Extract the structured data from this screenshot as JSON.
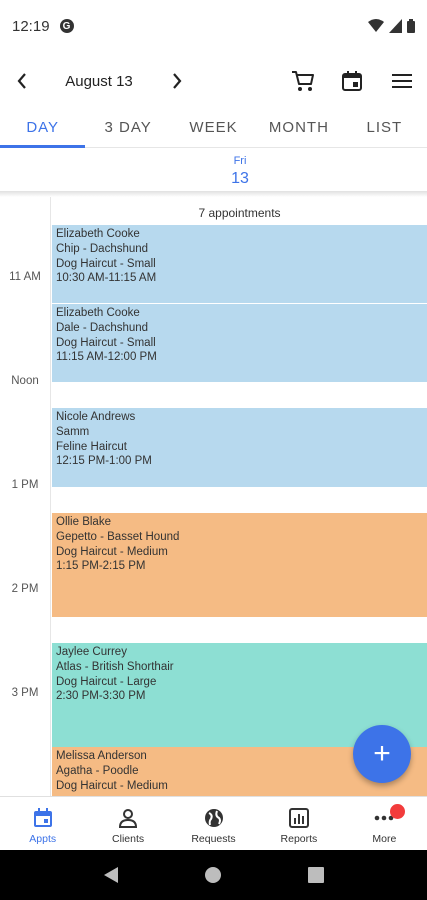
{
  "status_bar": {
    "time": "12:19",
    "g_badge": "G",
    "icons": [
      "wifi-icon",
      "signal-icon",
      "battery-icon"
    ]
  },
  "app_bar": {
    "prev_glyph": "‹",
    "next_glyph": "›",
    "date_title": "August 13",
    "icons": [
      "cart-icon",
      "calendar-icon",
      "menu-icon"
    ]
  },
  "tabs": [
    {
      "label": "DAY",
      "active": true
    },
    {
      "label": "3 DAY",
      "active": false
    },
    {
      "label": "WEEK",
      "active": false
    },
    {
      "label": "MONTH",
      "active": false
    },
    {
      "label": "LIST",
      "active": false
    }
  ],
  "day_header": {
    "day_name": "Fri",
    "day_number": "13"
  },
  "calendar": {
    "appointment_count": "7 appointments",
    "hour_labels": [
      "11 AM",
      "Noon",
      "1 PM",
      "2 PM",
      "3 PM"
    ],
    "events": [
      {
        "lines": [
          "Elizabeth Cooke",
          "Chip - Dachshund",
          "Dog Haircut - Small",
          "10:30 AM-11:15 AM"
        ],
        "color": "#b7d9ee"
      },
      {
        "lines": [
          "Elizabeth Cooke",
          "Dale - Dachshund",
          "Dog Haircut - Small",
          "11:15 AM-12:00 PM"
        ],
        "color": "#b7d9ee"
      },
      {
        "lines": [
          "Nicole Andrews",
          "Samm",
          "Feline Haircut",
          "12:15 PM-1:00 PM"
        ],
        "color": "#b7d9ee"
      },
      {
        "lines": [
          "Ollie Blake",
          "Gepetto - Basset Hound",
          "Dog Haircut - Medium",
          "1:15 PM-2:15 PM"
        ],
        "color": "#f5bb84"
      },
      {
        "lines": [
          "Jaylee Currey",
          "Atlas - British Shorthair",
          "Dog Haircut - Large",
          "2:30 PM-3:30 PM"
        ],
        "color": "#8ddfd3"
      },
      {
        "lines": [
          "Melissa Anderson",
          "Agatha - Poodle",
          "Dog Haircut - Medium"
        ],
        "color": "#f5bb84"
      }
    ]
  },
  "fab": {
    "label": "+"
  },
  "bottom_nav": [
    {
      "label": "Appts",
      "icon": "calendar-icon",
      "active": true
    },
    {
      "label": "Clients",
      "icon": "person-icon",
      "active": false
    },
    {
      "label": "Requests",
      "icon": "globe-icon",
      "active": false
    },
    {
      "label": "Reports",
      "icon": "report-icon",
      "active": false
    },
    {
      "label": "More",
      "icon": "more-icon",
      "active": false
    }
  ],
  "colors": {
    "accent": "#3d73e8",
    "blue_event": "#b7d9ee",
    "orange_event": "#f5bb84",
    "teal_event": "#8ddfd3",
    "badge": "#f23c3c"
  }
}
